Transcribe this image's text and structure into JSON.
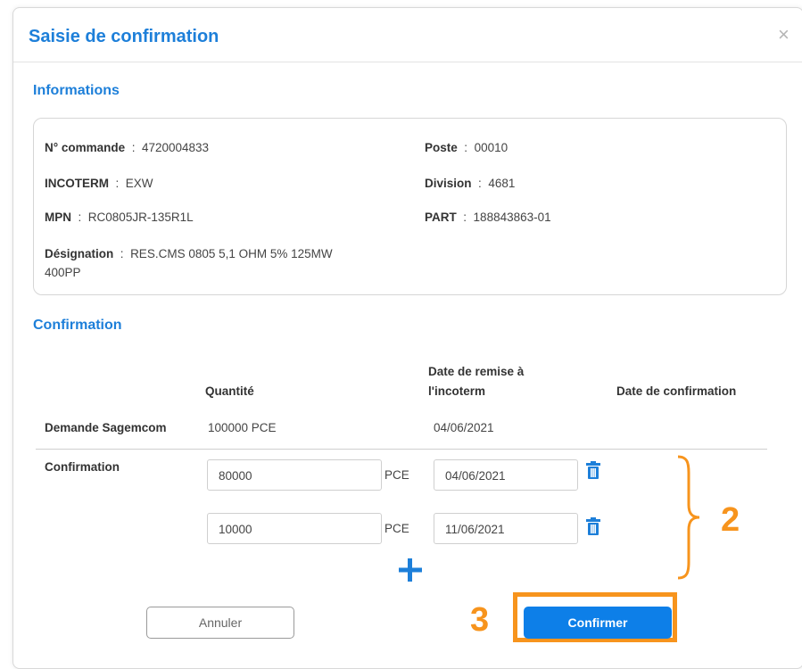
{
  "modal": {
    "title": "Saisie de confirmation",
    "close_icon": "×"
  },
  "informations": {
    "section_title": "Informations",
    "fields": {
      "commande_label": "N° commande",
      "commande_value": "4720004833",
      "poste_label": "Poste",
      "poste_value": "00010",
      "incoterm_label": "INCOTERM",
      "incoterm_value": "EXW",
      "division_label": "Division",
      "division_value": "4681",
      "mpn_label": "MPN",
      "mpn_value": "RC0805JR-135R1L",
      "part_label": "PART",
      "part_value": "188843863-01",
      "designation_label": "Désignation",
      "designation_value_line1": "RES.CMS 0805 5,1 OHM 5% 125MW",
      "designation_value_line2": "400PP"
    },
    "separator": ":"
  },
  "confirmation": {
    "section_title": "Confirmation",
    "headers": {
      "quantite": "Quantité",
      "date_remise_line1": "Date de remise à",
      "date_remise_line2": "l'incoterm",
      "date_confirmation": "Date de confirmation"
    },
    "demande": {
      "label": "Demande Sagemcom",
      "quantite": "100000 PCE",
      "date": "04/06/2021"
    },
    "row_label": "Confirmation",
    "rows": [
      {
        "quantity": "80000",
        "unit": "PCE",
        "date": "04/06/2021"
      },
      {
        "quantity": "10000",
        "unit": "PCE",
        "date": "11/06/2021"
      }
    ]
  },
  "buttons": {
    "cancel": "Annuler",
    "confirm": "Confirmer"
  },
  "annotations": {
    "label_2": "2",
    "label_3": "3",
    "color": "#f7941d"
  },
  "colors": {
    "accent": "#1d7fd9",
    "primary_button": "#0d7fe8"
  }
}
